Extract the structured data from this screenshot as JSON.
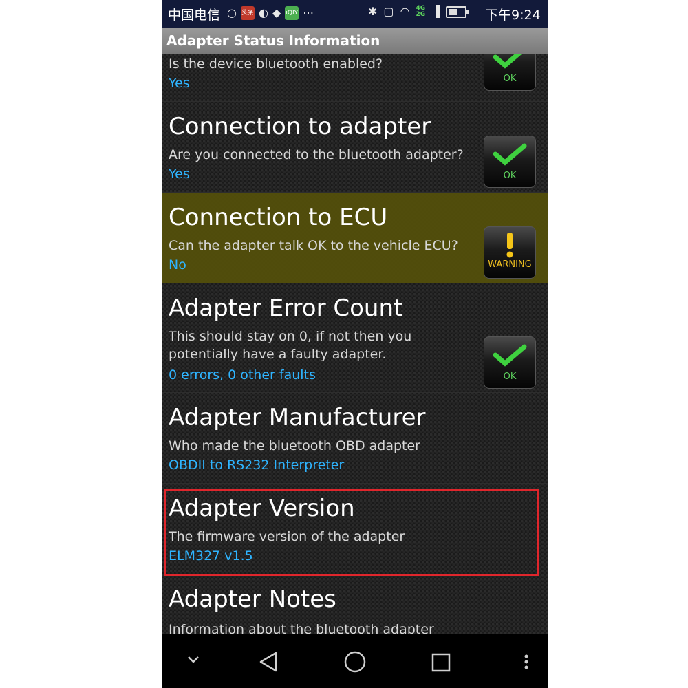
{
  "status_bar": {
    "carrier": "中国电信",
    "time": "下午9:24",
    "badge_toutiao": "头条",
    "badge_iqiyi": "iQIY",
    "network_top": "4G",
    "network_bottom": "2G"
  },
  "title_bar": {
    "title": "Adapter Status Information"
  },
  "items": [
    {
      "title": "",
      "desc": "Is the device bluetooth enabled?",
      "value": "Yes",
      "status": "OK"
    },
    {
      "title": "Connection to adapter",
      "desc": "Are you connected to the bluetooth adapter?",
      "value": "Yes",
      "status": "OK"
    },
    {
      "title": "Connection to ECU",
      "desc": "Can the adapter talk OK to the vehicle ECU?",
      "value": "No",
      "status": "WARNING"
    },
    {
      "title": "Adapter Error Count",
      "desc": "This should stay on 0, if not then you potentially have a faulty adapter.",
      "value": "0 errors, 0 other faults",
      "status": "OK"
    },
    {
      "title": "Adapter Manufacturer",
      "desc": "Who made the bluetooth OBD adapter",
      "value": "OBDII to RS232 Interpreter"
    },
    {
      "title": "Adapter Version",
      "desc": "The firmware version of the adapter",
      "value": "ELM327 v1.5"
    },
    {
      "title": "Adapter Notes",
      "desc": "Information about the bluetooth adapter",
      "value": ""
    }
  ],
  "colors": {
    "accent_value": "#2eb4ff",
    "ok_green": "#5ed35e",
    "warning_yellow": "#f0c020",
    "highlight_red": "#e0262c"
  },
  "icons": {
    "nav": [
      "chevron-down-icon",
      "back-icon",
      "home-icon",
      "recents-icon",
      "overflow-menu-icon"
    ]
  }
}
